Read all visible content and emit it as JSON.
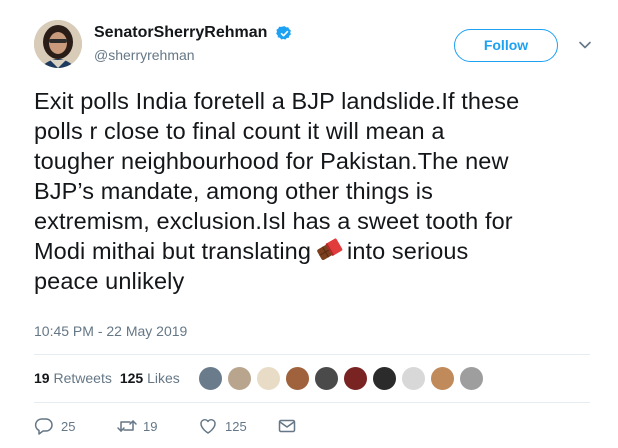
{
  "author": {
    "display_name": "SenatorSherryRehman",
    "handle": "@sherryrehman",
    "verified": true,
    "avatar": "avatar-photo"
  },
  "follow_button": {
    "label": "Follow"
  },
  "more_menu": {
    "icon": "chevron-down-icon"
  },
  "tweet": {
    "lines": [
      "Exit polls India foretell a BJP landslide.If these",
      "polls r close to final count it will mean a",
      "tougher neighbourhood for Pakistan.The new",
      "BJP’s mandate, among other things is",
      "extremism, exclusion.Isl has a sweet tooth for",
      "Modi mithai but translating",
      "into serious",
      "peace unlikely"
    ],
    "emoji": "chocolate-bar-icon",
    "timestamp": "10:45 PM - 22 May 2019"
  },
  "stats": {
    "retweets": {
      "count": "19",
      "label": "Retweets"
    },
    "likes": {
      "count": "125",
      "label": "Likes"
    },
    "liker_avatars": 10
  },
  "actions": {
    "reply": {
      "icon": "reply-icon",
      "count": "25"
    },
    "retweet": {
      "icon": "retweet-icon",
      "count": "19"
    },
    "like": {
      "icon": "heart-icon",
      "count": "125"
    },
    "message": {
      "icon": "envelope-icon"
    }
  },
  "colors": {
    "accent": "#1da1f2",
    "text": "#14171a",
    "muted": "#657786",
    "divider": "#e6ecf0"
  }
}
